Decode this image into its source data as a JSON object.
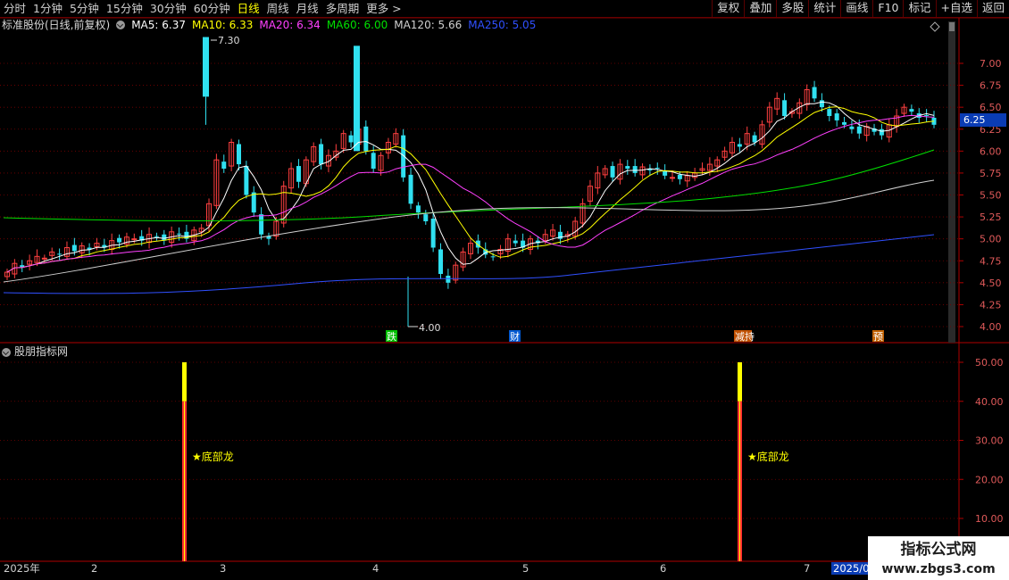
{
  "toolbar": {
    "periods": [
      "分时",
      "1分钟",
      "5分钟",
      "15分钟",
      "30分钟",
      "60分钟",
      "日线",
      "周线",
      "月线",
      "多周期",
      "更多 >"
    ],
    "active_period": "日线",
    "tools": [
      "复权",
      "叠加",
      "多股",
      "统计",
      "画线",
      "F10",
      "标记",
      "+自选",
      "返回"
    ]
  },
  "main_chart": {
    "stock_title": "标准股份(日线,前复权)",
    "ma_legend": [
      {
        "label": "MA5: 6.37",
        "color": "#ffffff"
      },
      {
        "label": "MA10: 6.33",
        "color": "#ffff00"
      },
      {
        "label": "MA20: 6.34",
        "color": "#ff40ff"
      },
      {
        "label": "MA60: 6.00",
        "color": "#00e000"
      },
      {
        "label": "MA120: 5.66",
        "color": "#d0d0d0"
      },
      {
        "label": "MA250: 5.05",
        "color": "#3050ff"
      }
    ],
    "y_axis_labels": [
      "7.00",
      "6.75",
      "6.50",
      "6.25",
      "6.00",
      "5.75",
      "5.50",
      "5.25",
      "5.00",
      "4.75",
      "4.50",
      "4.25",
      "4.00"
    ],
    "current_price": "6.25",
    "high_label": "7.30",
    "low_label": "4.00",
    "event_markers": [
      {
        "label": "跌",
        "color": "#00c000",
        "text_color": "#ffffff"
      },
      {
        "label": "财",
        "color": "#0058d0",
        "text_color": "#ffffff"
      },
      {
        "label": "减持",
        "color": "#c05000",
        "text_color": "#ffffff"
      },
      {
        "label": "预",
        "color": "#c06000",
        "text_color": "#ffffff"
      }
    ]
  },
  "indicator_panel": {
    "title": "股朋指标网",
    "y_axis_labels": [
      "50.00",
      "40.00",
      "30.00",
      "20.00",
      "10.00"
    ],
    "signals": [
      {
        "label": "★底部龙",
        "value": 50
      },
      {
        "label": "★底部龙",
        "value": 50
      }
    ]
  },
  "date_axis": [
    "2025年",
    "2",
    "3",
    "4",
    "5",
    "6",
    "7",
    "2025/07"
  ],
  "watermark": {
    "line1": "指标公式网",
    "line2": "www.zbgs3.com"
  },
  "colors": {
    "up": "#ff4040",
    "down": "#30e0f0",
    "grid": "#7a0000",
    "axis_text": "#e05a5a",
    "signal_yellow": "#ffff00",
    "signal_red": "#ff3030"
  }
}
